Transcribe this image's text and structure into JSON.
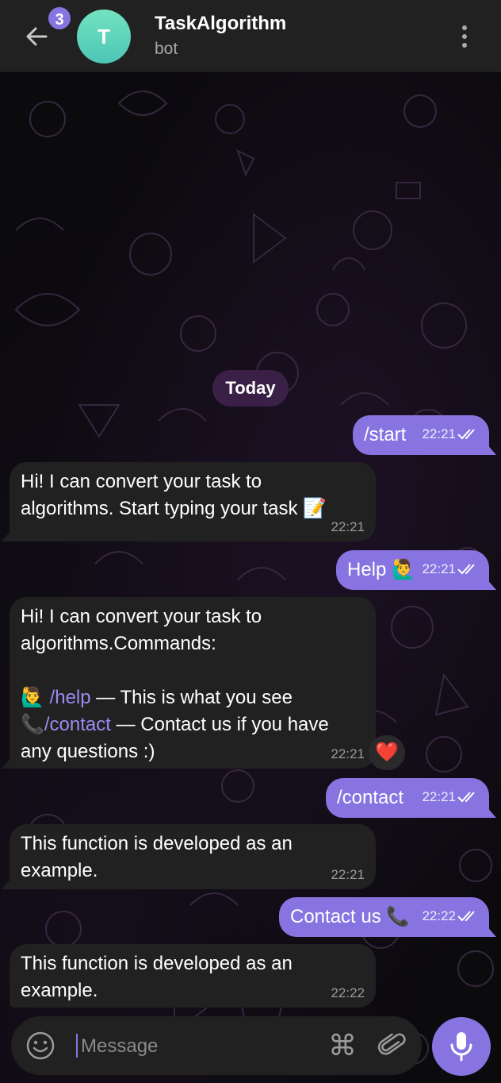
{
  "header": {
    "unread_count": "3",
    "avatar_letter": "T",
    "title": "TaskAlgorithm",
    "subtitle": "bot"
  },
  "date_separator": "Today",
  "messages": [
    {
      "dir": "out",
      "text": "/start",
      "time": "22:21",
      "status": "read"
    },
    {
      "dir": "in",
      "text": "Hi! I can convert your task to algorithms. Start typing your task 📝",
      "time": "22:21"
    },
    {
      "dir": "out",
      "text": "Help 🙋‍♂️",
      "time": "22:21",
      "status": "read"
    },
    {
      "dir": "in",
      "lines": {
        "intro_1": "Hi! I can convert your task to",
        "intro_2": "algorithms.Commands:",
        "help_emoji": "🙋‍♂️",
        "help_cmd": "/help",
        "help_desc": " — This is what you see",
        "contact_emoji": "📞",
        "contact_cmd": "/contact",
        "contact_desc": " — Contact us if you have",
        "contact_desc_2": "any questions :)"
      },
      "time": "22:21",
      "reaction": "❤️"
    },
    {
      "dir": "out",
      "text": "/contact",
      "time": "22:21",
      "status": "read"
    },
    {
      "dir": "in",
      "text": "This function is developed as an example.",
      "time": "22:21"
    },
    {
      "dir": "out",
      "text": "Contact us 📞",
      "time": "22:22",
      "status": "read"
    },
    {
      "dir": "in",
      "text": "This function is developed as an example.",
      "time": "22:22"
    }
  ],
  "composer": {
    "placeholder": "Message"
  },
  "icons": {
    "back": "back-arrow-icon",
    "menu": "more-vertical-icon",
    "emoji": "emoji-icon",
    "commands": "command-icon",
    "attach": "paperclip-icon",
    "mic": "microphone-icon",
    "read": "double-check-icon"
  },
  "colors": {
    "accent": "#8774e1",
    "incoming_bubble": "#212121",
    "header": "#212121",
    "date_pill": "#3a2046",
    "avatar": "#5dd6bb"
  }
}
